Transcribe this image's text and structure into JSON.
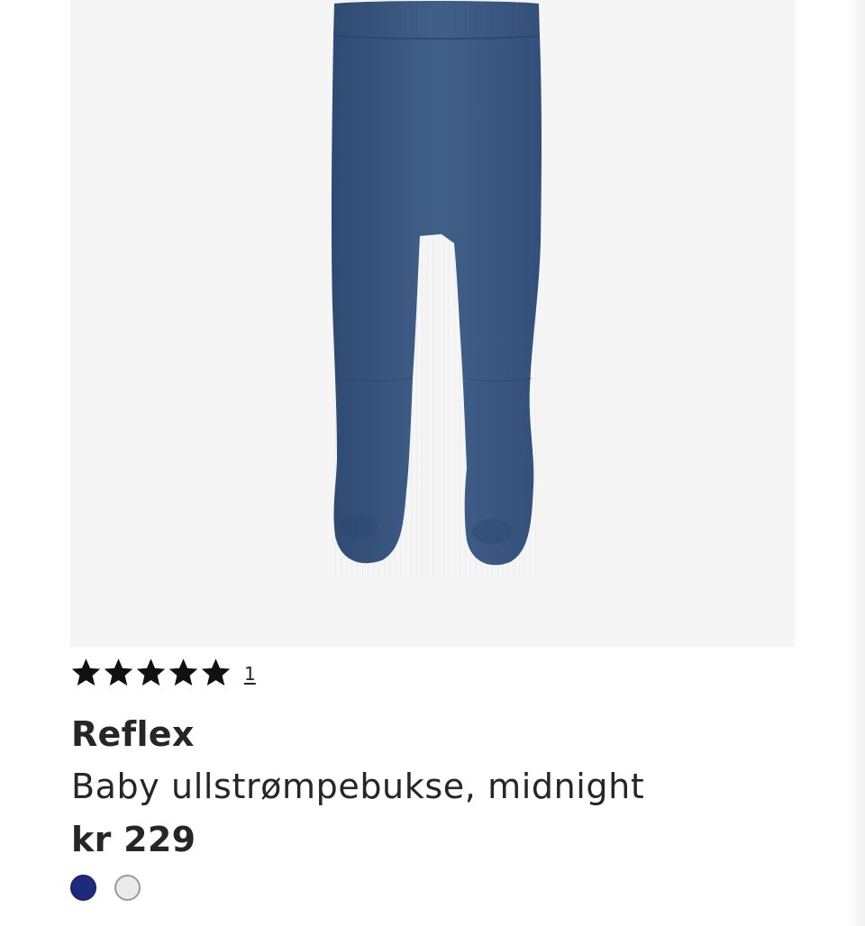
{
  "product": {
    "image_alt": "Baby wool tights in midnight blue",
    "rating": {
      "stars": 5,
      "max_stars": 5,
      "review_count": "1"
    },
    "brand": "Reflex",
    "name": "Baby ullstrømpebukse, midnight",
    "price": "kr 229",
    "swatches": [
      {
        "color": "#1e2a7c",
        "selected": true
      },
      {
        "color": "#ebebeb",
        "selected": false
      }
    ]
  },
  "colors": {
    "image_background": "#f5f5f6",
    "tights": "#3d5a85",
    "text": "#262626"
  }
}
